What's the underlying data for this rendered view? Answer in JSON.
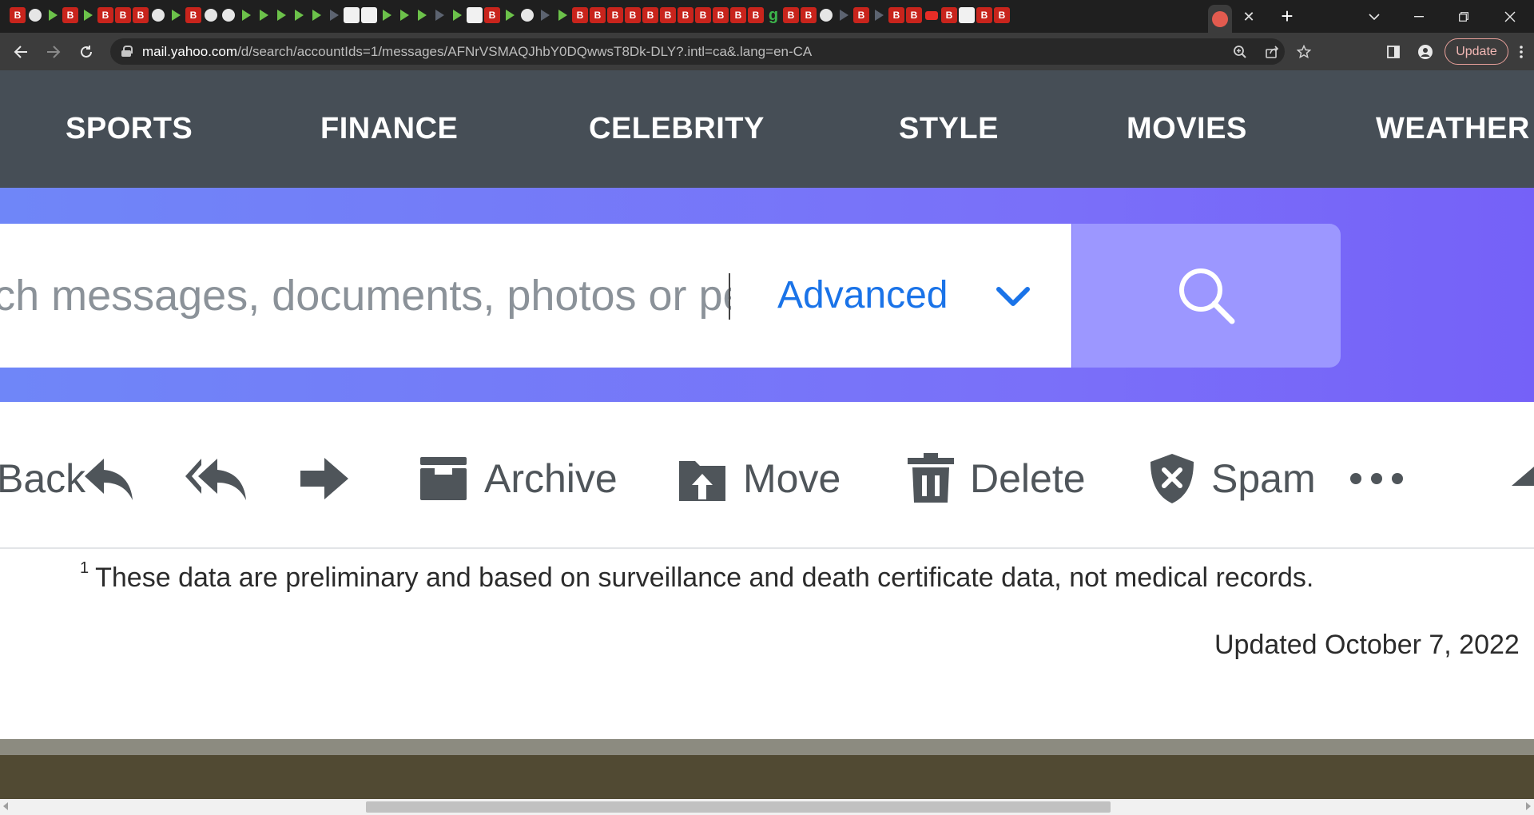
{
  "browser": {
    "url_host": "mail.yahoo.com",
    "url_path": "/d/search/accountIds=1/messages/AFNrVSMAQJhbY0DQwwsT8Dk-DLY?.intl=ca&.lang=en-CA",
    "update_label": "Update",
    "favicons": [
      "b",
      "globe",
      "play",
      "b",
      "play",
      "b",
      "b",
      "b",
      "globe",
      "play",
      "b",
      "globe",
      "globe",
      "play",
      "play",
      "play",
      "play",
      "play",
      "play2",
      "white",
      "white",
      "play",
      "play",
      "play",
      "play2",
      "play",
      "white",
      "b",
      "play",
      "globe",
      "play2",
      "play",
      "b",
      "b",
      "b",
      "b",
      "b",
      "b",
      "b",
      "b",
      "b",
      "b",
      "b",
      "g",
      "b",
      "b",
      "globe",
      "play2",
      "b",
      "play2",
      "b",
      "b",
      "yt",
      "b",
      "white",
      "b",
      "b"
    ]
  },
  "nav": {
    "links": [
      "SPORTS",
      "FINANCE",
      "CELEBRITY",
      "STYLE",
      "MOVIES",
      "WEATHER"
    ]
  },
  "search": {
    "placeholder": "Search messages, documents, photos or people",
    "advanced_label": "Advanced"
  },
  "actions": {
    "back_label": "Back",
    "archive_label": "Archive",
    "move_label": "Move",
    "delete_label": "Delete",
    "spam_label": "Spam"
  },
  "document": {
    "footnote_marker": "1",
    "footnote_text": "These data are preliminary and based on surveillance and death certificate data, not medical records.",
    "updated_text": "Updated October 7, 2022"
  },
  "colors": {
    "nav_bg": "#464e56",
    "accent_link": "#1a73e8",
    "search_button": "#9c97ff"
  }
}
